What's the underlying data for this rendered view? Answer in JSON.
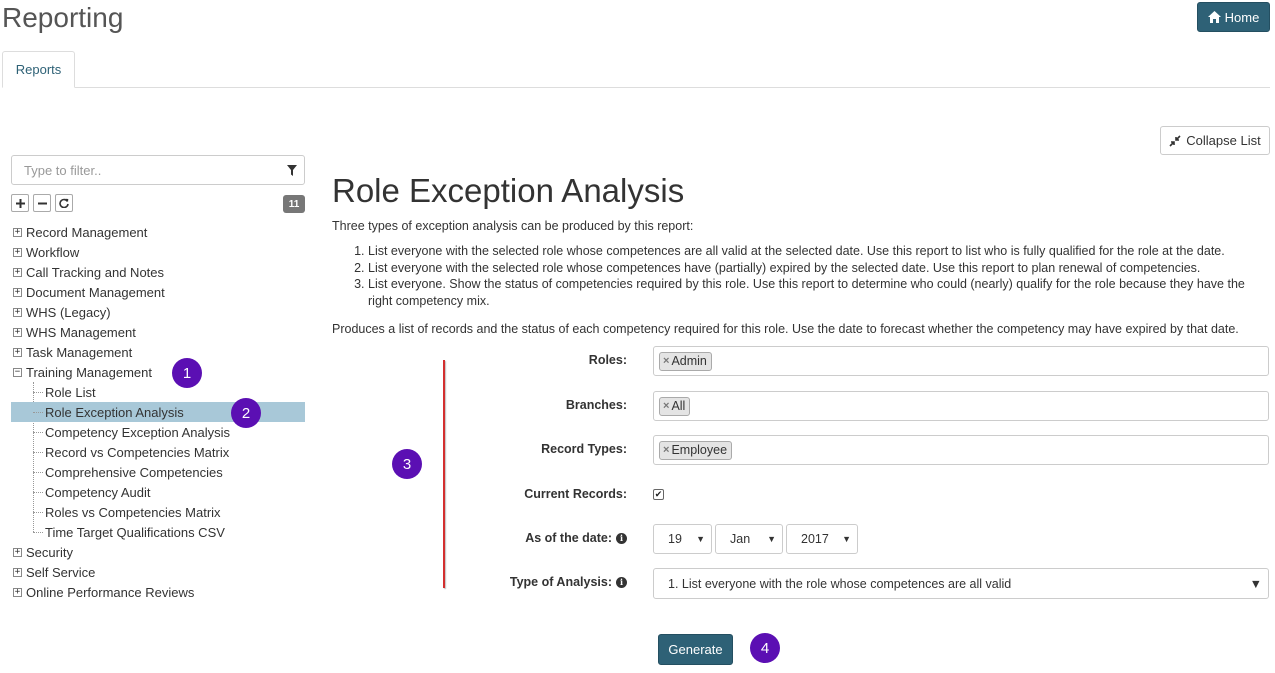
{
  "header": {
    "title": "Reporting",
    "home_label": "Home"
  },
  "tabs": [
    {
      "label": "Reports"
    }
  ],
  "collapse_label": "Collapse List",
  "sidebar": {
    "filter_placeholder": "Type to filter..",
    "count": "11",
    "tree": [
      {
        "label": "Record Management",
        "expanded": false
      },
      {
        "label": "Workflow",
        "expanded": false
      },
      {
        "label": "Call Tracking and Notes",
        "expanded": false
      },
      {
        "label": "Document Management",
        "expanded": false
      },
      {
        "label": "WHS (Legacy)",
        "expanded": false
      },
      {
        "label": "WHS Management",
        "expanded": false
      },
      {
        "label": "Task Management",
        "expanded": false
      },
      {
        "label": "Training Management",
        "expanded": true,
        "children": [
          {
            "label": "Role List"
          },
          {
            "label": "Role Exception Analysis",
            "selected": true
          },
          {
            "label": "Competency Exception Analysis"
          },
          {
            "label": "Record vs Competencies Matrix"
          },
          {
            "label": "Comprehensive Competencies"
          },
          {
            "label": "Competency Audit"
          },
          {
            "label": "Roles vs Competencies Matrix"
          },
          {
            "label": "Time Target Qualifications CSV"
          }
        ]
      },
      {
        "label": "Security",
        "expanded": false
      },
      {
        "label": "Self Service",
        "expanded": false
      },
      {
        "label": "Online Performance Reviews",
        "expanded": false
      }
    ]
  },
  "main": {
    "title": "Role Exception Analysis",
    "intro": "Three types of exception analysis can be produced by this report:",
    "steps": [
      "List everyone with the selected role whose competences are all valid at the selected date. Use this report to list who is fully qualified for the role at the date.",
      "List everyone with the selected role whose competences have (partially) expired by the selected date. Use this report to plan renewal of competencies.",
      "List everyone. Show the status of competencies required by this role. Use this report to determine who could (nearly) qualify for the role because they have the right competency mix."
    ],
    "description": "Produces a list of records and the status of each competency required for this role. Use the date to forecast whether the competency may have expired by that date.",
    "form": {
      "roles_label": "Roles:",
      "roles": [
        "Admin"
      ],
      "branches_label": "Branches:",
      "branches": [
        "All"
      ],
      "record_types_label": "Record Types:",
      "record_types": [
        "Employee"
      ],
      "current_records_label": "Current Records:",
      "current_records": true,
      "date_label": "As of the date:",
      "date_day": "19",
      "date_month": "Jan",
      "date_year": "2017",
      "analysis_label": "Type of Analysis:",
      "analysis_value": "1. List everyone with the role whose competences are all valid",
      "generate_label": "Generate"
    }
  },
  "annotations": [
    "1",
    "2",
    "3",
    "4"
  ],
  "colors": {
    "accent": "#2e6176",
    "selected": "#a8c8d8",
    "bubble": "#5b0fb3",
    "marker_line": "#d32f2f"
  }
}
